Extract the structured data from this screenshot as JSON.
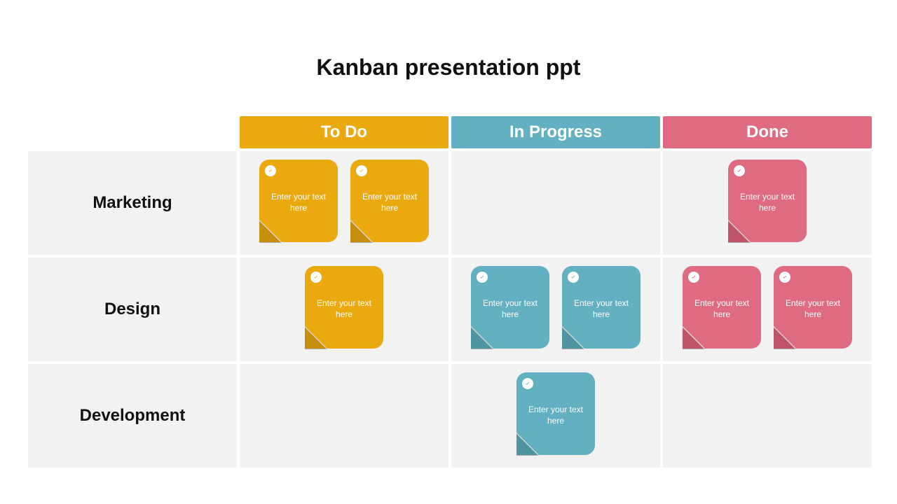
{
  "title": "Kanban presentation ppt",
  "columns": {
    "todo": {
      "label": "To Do",
      "color": "#eaa90f"
    },
    "progress": {
      "label": "In Progress",
      "color": "#62b0c1"
    },
    "done": {
      "label": "Done",
      "color": "#de6b80"
    }
  },
  "rows": {
    "marketing": {
      "label": "Marketing"
    },
    "design": {
      "label": "Design"
    },
    "development": {
      "label": "Development"
    }
  },
  "card_placeholder": "Enter your text here",
  "cells": {
    "marketing": {
      "todo": 2,
      "progress": 0,
      "done": 1
    },
    "design": {
      "todo": 1,
      "progress": 2,
      "done": 2
    },
    "development": {
      "todo": 0,
      "progress": 1,
      "done": 0
    }
  }
}
